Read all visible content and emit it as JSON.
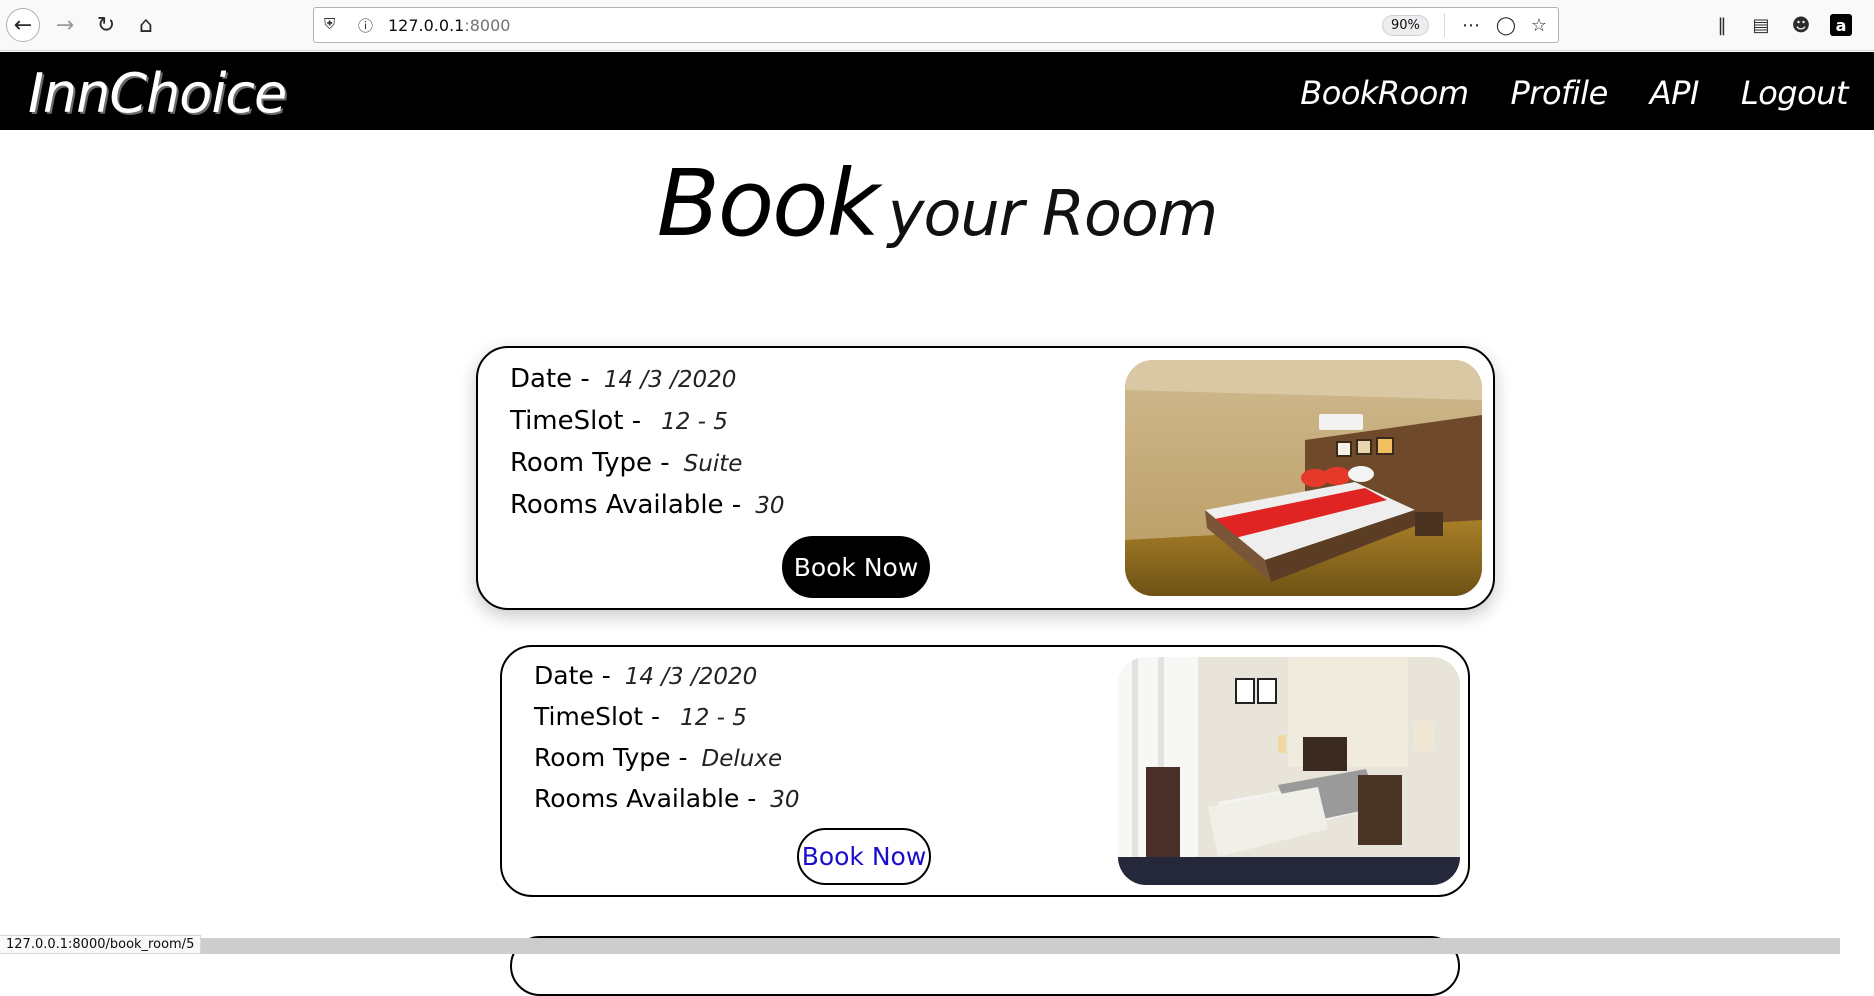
{
  "browser": {
    "url_host": "127.0.0.1",
    "url_port": ":8000",
    "zoom": "90%",
    "status_url": "127.0.0.1:8000/book_room/5"
  },
  "site": {
    "logo": "InnChoice",
    "nav": [
      "BookRoom",
      "Profile",
      "API",
      "Logout"
    ]
  },
  "heading": {
    "big": "Book",
    "small": "your Room"
  },
  "labels": {
    "date": "Date -",
    "timeslot": "TimeSlot -",
    "room_type": "Room Type -",
    "rooms_available": "Rooms Available -"
  },
  "rooms": [
    {
      "date": "14 /3 /2020",
      "timeslot": "12 - 5",
      "room_type": "Suite",
      "rooms_available": "30",
      "button": "Book Now"
    },
    {
      "date": "14 /3 /2020",
      "timeslot": "12 - 5",
      "room_type": "Deluxe",
      "rooms_available": "30",
      "button": "Book Now"
    }
  ],
  "colors": {
    "nav_bg": "#000000",
    "link_blue": "#1a0dce"
  }
}
